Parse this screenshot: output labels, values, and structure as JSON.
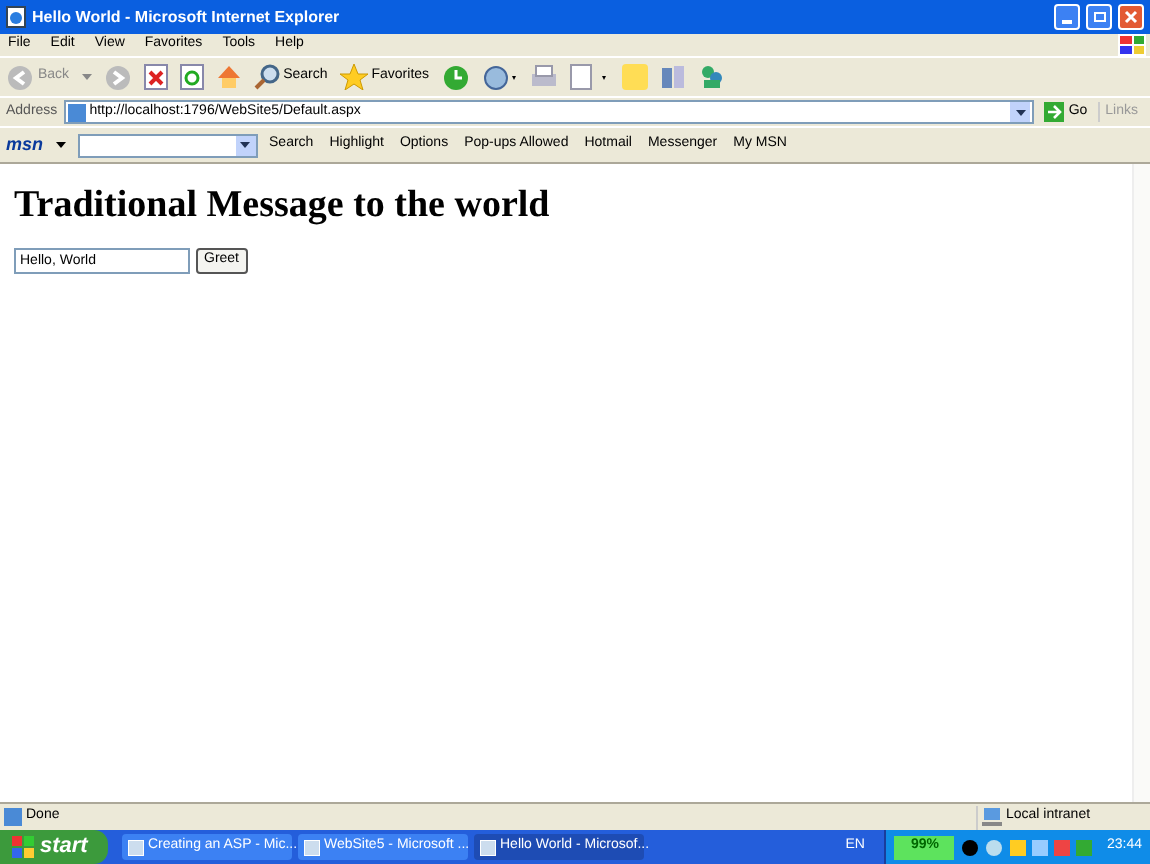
{
  "window": {
    "title": "Hello World - Microsoft Internet Explorer"
  },
  "menu": [
    "File",
    "Edit",
    "View",
    "Favorites",
    "Tools",
    "Help"
  ],
  "toolbar": {
    "back": "Back",
    "search": "Search",
    "favorites": "Favorites"
  },
  "address_bar": {
    "label": "Address",
    "url": "http://localhost:1796/WebSite5/Default.aspx",
    "go": "Go",
    "links": "Links"
  },
  "msn_bar": {
    "logo": "msn",
    "items": [
      "Search",
      "Highlight",
      "Options",
      "Pop-ups Allowed",
      "Hotmail",
      "Messenger",
      "My MSN"
    ]
  },
  "page": {
    "heading": "Traditional Message to the world",
    "input_value": "Hello, World",
    "button": "Greet"
  },
  "status_bar": {
    "status": "Done",
    "zone": "Local intranet"
  },
  "taskbar": {
    "start": "start",
    "tasks": [
      {
        "label": "Creating an ASP - Mic...",
        "selected": false
      },
      {
        "label": "WebSite5 - Microsoft ...",
        "selected": false
      },
      {
        "label": "Hello World - Microsof...",
        "selected": true
      }
    ],
    "language": "EN",
    "battery": "99%",
    "clock": "23:44"
  }
}
